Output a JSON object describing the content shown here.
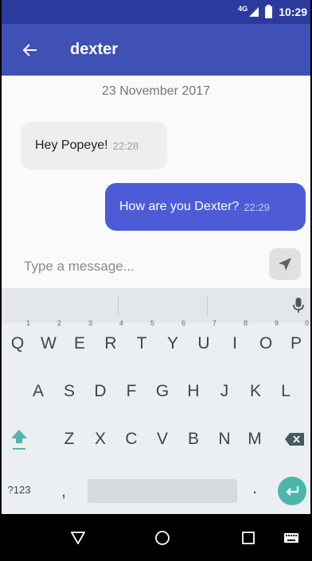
{
  "status_bar": {
    "network": "4G",
    "time": "10:29"
  },
  "app_bar": {
    "title": "dexter",
    "back_icon": "arrow-back-icon"
  },
  "chat": {
    "date_separator": "23 November 2017",
    "messages": [
      {
        "direction": "incoming",
        "text": "Hey Popeye!",
        "time": "22:28"
      },
      {
        "direction": "outgoing",
        "text": "How are you Dexter?",
        "time": "22:29"
      }
    ]
  },
  "composer": {
    "placeholder": "Type a message...",
    "send_icon": "send-icon"
  },
  "keyboard": {
    "row1": [
      {
        "key": "Q",
        "hint": "1"
      },
      {
        "key": "W",
        "hint": "2"
      },
      {
        "key": "E",
        "hint": "3"
      },
      {
        "key": "R",
        "hint": "4"
      },
      {
        "key": "T",
        "hint": "5"
      },
      {
        "key": "Y",
        "hint": "6"
      },
      {
        "key": "U",
        "hint": "7"
      },
      {
        "key": "I",
        "hint": "8"
      },
      {
        "key": "O",
        "hint": "9"
      },
      {
        "key": "P",
        "hint": "0"
      }
    ],
    "row2": [
      "A",
      "S",
      "D",
      "F",
      "G",
      "H",
      "J",
      "K",
      "L"
    ],
    "row3": [
      "Z",
      "X",
      "C",
      "V",
      "B",
      "N",
      "M"
    ],
    "row4": {
      "symbols": "?123",
      "comma": ",",
      "period": "."
    }
  },
  "colors": {
    "status_bar": "#2d3a9d",
    "app_bar": "#3f51b5",
    "outgoing_bubble": "#4d5cd6",
    "incoming_bubble": "#eeeeee",
    "enter_key": "#4db6ac",
    "shift_key": "#4db6ac"
  }
}
